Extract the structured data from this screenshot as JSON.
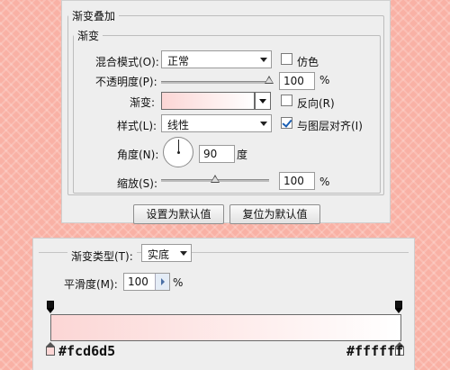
{
  "gradient_overlay": {
    "section_title": "渐变叠加",
    "group_title": "渐变",
    "blend_mode": {
      "label": "混合模式(O):",
      "value": "正常"
    },
    "dither": {
      "label": "仿色",
      "checked": false
    },
    "opacity": {
      "label": "不透明度(P):",
      "value": "100",
      "unit": "%",
      "level": 1.0
    },
    "gradient": {
      "label": "渐变:",
      "start_color": "#fcd6d5",
      "end_color": "#ffffff"
    },
    "reverse": {
      "label": "反向(R)",
      "checked": false
    },
    "style": {
      "label": "样式(L):",
      "value": "线性"
    },
    "align_with_layer": {
      "label": "与图层对齐(I)",
      "checked": true
    },
    "angle": {
      "label": "角度(N):",
      "value": "90",
      "unit": "度"
    },
    "scale": {
      "label": "缩放(S):",
      "value": "100",
      "unit": "%",
      "level": 0.5
    },
    "buttons": {
      "make_default": "设置为默认值",
      "reset_default": "复位为默认值"
    }
  },
  "gradient_editor": {
    "type": {
      "label": "渐变类型(T):",
      "value": "实底"
    },
    "smoothness": {
      "label": "平滑度(M):",
      "value": "100",
      "unit": "%"
    },
    "start_hex": "#fcd6d5",
    "end_hex": "#ffffff"
  },
  "colors": {
    "background": "#f9b1a5",
    "panel": "#eeeeee",
    "gradient_start": "#fcd6d5",
    "gradient_end": "#ffffff"
  },
  "icons": {
    "select_arrow": "chevron-down-icon",
    "angle_dial": "angle-dial-icon",
    "opacity_stop": "opacity-stop-icon",
    "color_stop": "color-stop-icon",
    "stepper": "stepper-arrow-icon"
  }
}
